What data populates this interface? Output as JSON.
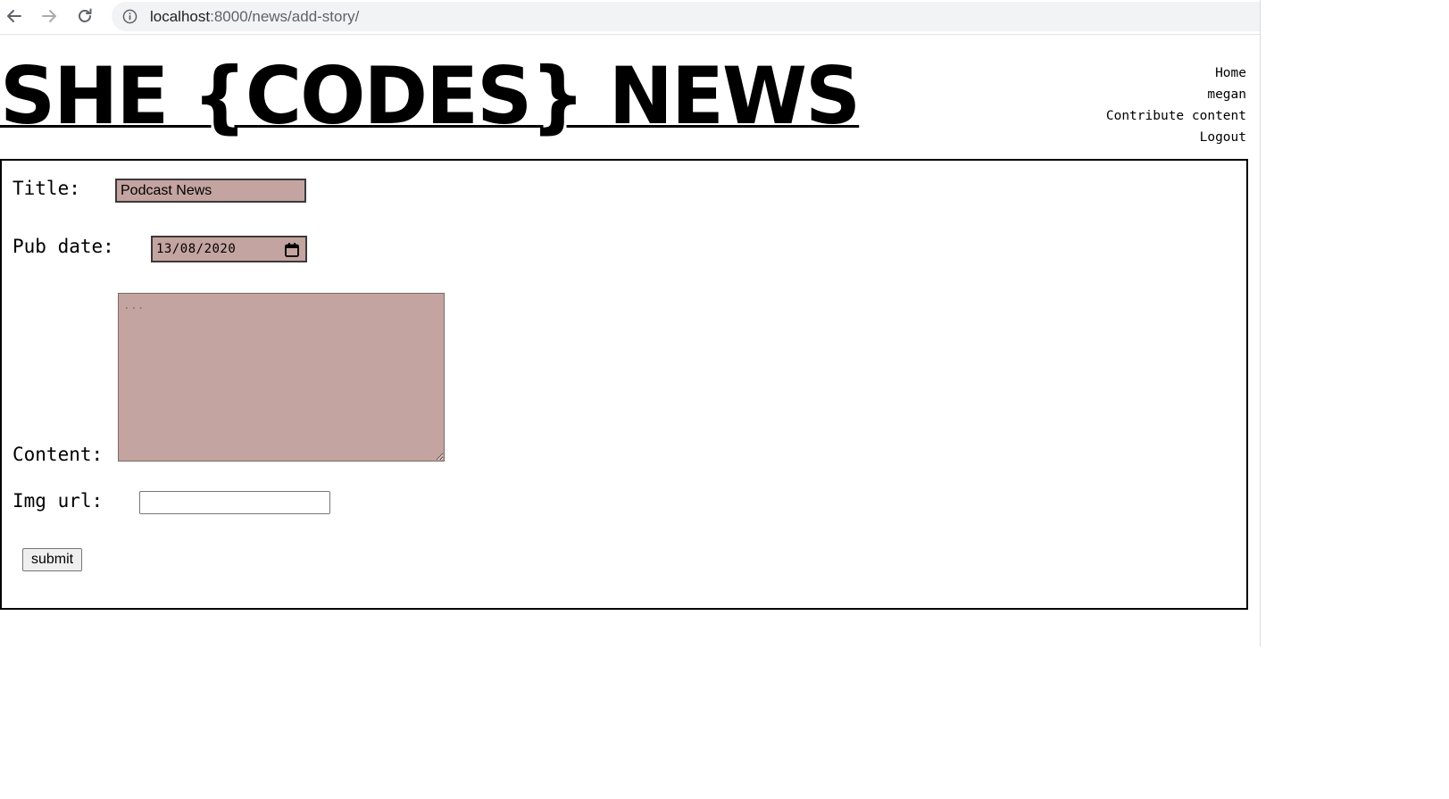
{
  "browser": {
    "url_host": "localhost",
    "url_path": ":8000/news/add-story/",
    "back_icon": "arrow-left-icon",
    "forward_icon": "arrow-right-icon",
    "reload_icon": "reload-icon",
    "info_icon": "info-icon"
  },
  "header": {
    "site_title": "SHE {CODES} NEWS",
    "nav": [
      {
        "label": "Home"
      },
      {
        "label": "megan"
      },
      {
        "label": "Contribute content"
      },
      {
        "label": "Logout"
      }
    ]
  },
  "form": {
    "title_label": "Title:",
    "title_value": "Podcast News",
    "pub_date_label": "Pub date:",
    "pub_date_value": "13/08/2020",
    "content_label": "Content:",
    "content_placeholder": "...",
    "content_value": "",
    "img_url_label": "Img url:",
    "img_url_value": "",
    "submit_label": "submit"
  },
  "colors": {
    "input_fill": "#c4a4a0",
    "text": "#000000",
    "border": "#000000"
  }
}
